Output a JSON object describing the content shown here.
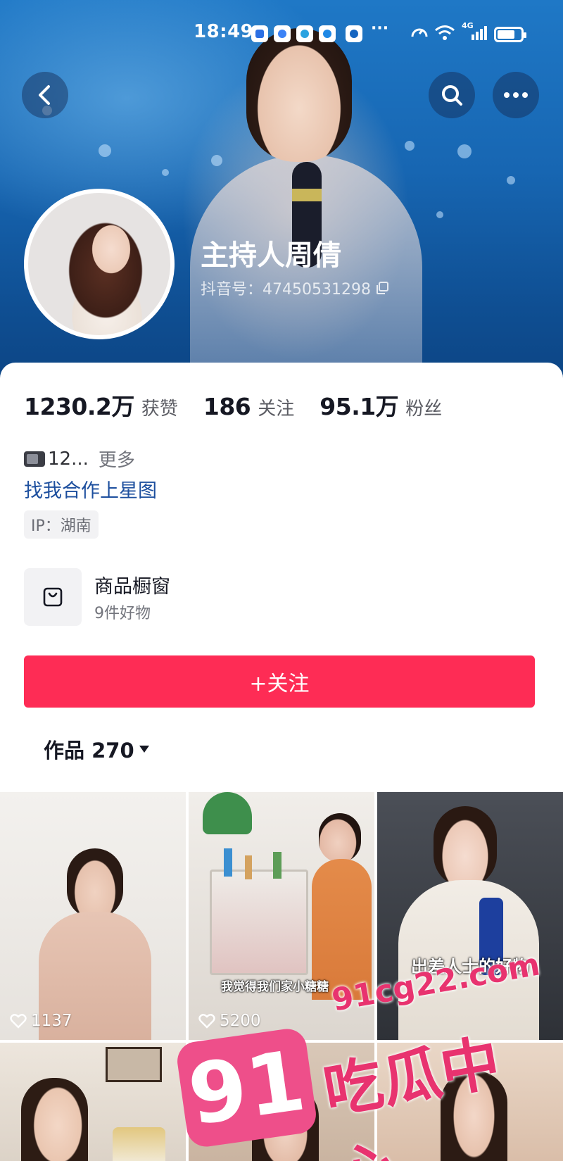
{
  "status_bar": {
    "time": "18:49",
    "more": "···",
    "network": "4G"
  },
  "header": {
    "back_icon": "back-chevron-icon",
    "search_icon": "search-icon",
    "more_icon": "more-dots-icon"
  },
  "profile": {
    "name": "主持人周倩",
    "douyin_id": "抖音号：47450531298",
    "copy_icon": "copy-icon"
  },
  "stats": [
    {
      "value": "1230.2万",
      "label": "获赞"
    },
    {
      "value": "186",
      "label": "关注"
    },
    {
      "value": "95.1万",
      "label": "粉丝"
    }
  ],
  "bio": {
    "text": "12...",
    "more": "更多",
    "link": "找我合作上星图",
    "ip": "IP：湖南"
  },
  "shop": {
    "title": "商品橱窗",
    "subtitle": "9件好物"
  },
  "actions": {
    "follow_label": "+关注"
  },
  "tabs": {
    "works_label": "作品 270"
  },
  "videos": [
    {
      "likes": "1137",
      "caption": ""
    },
    {
      "likes": "5200",
      "caption": "我觉得我们家小糖糖"
    },
    {
      "likes": "",
      "caption": "出差人士的好物"
    },
    {
      "likes": "",
      "caption": ""
    },
    {
      "likes": "",
      "caption": ""
    },
    {
      "likes": "",
      "caption": ""
    }
  ],
  "watermark": {
    "url": "91cg22.com",
    "number": "91",
    "name": "吃瓜中心"
  },
  "colors": {
    "accent": "#fe2c55",
    "link": "#1d4f9e",
    "watermark": "#e8336f"
  }
}
